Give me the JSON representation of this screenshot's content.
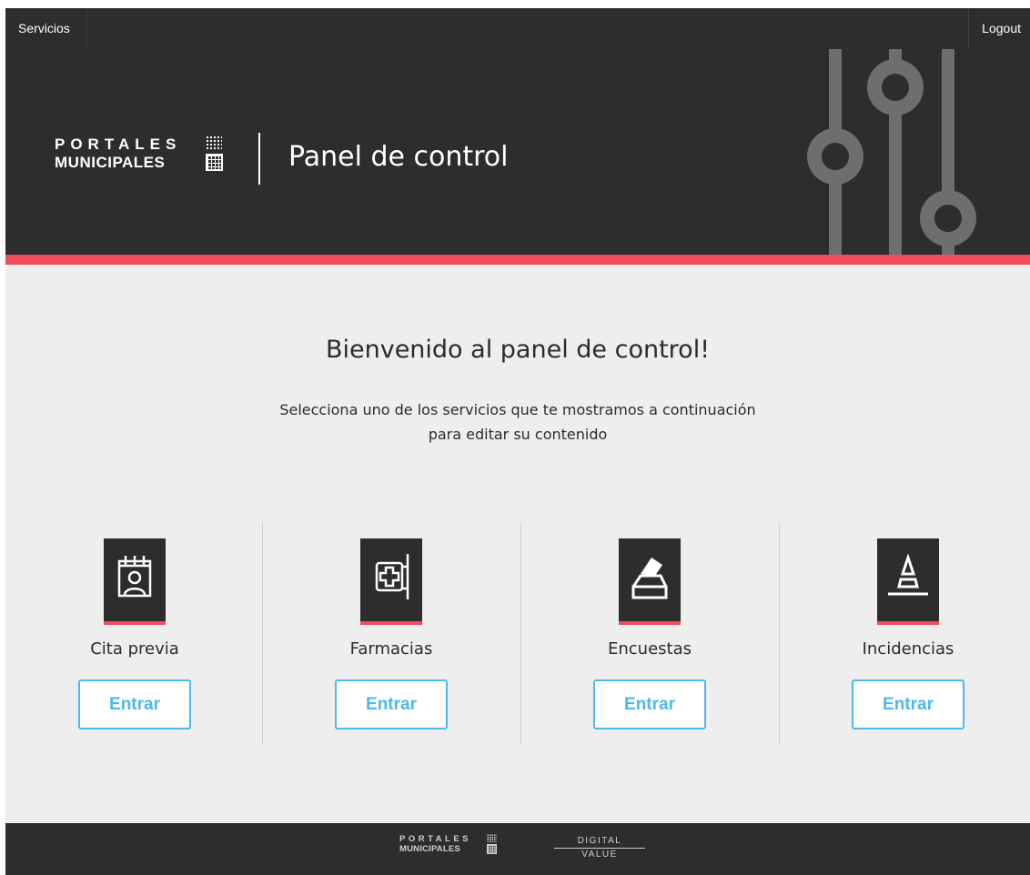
{
  "topbar": {
    "services_label": "Servicios",
    "logout_label": "Logout"
  },
  "header": {
    "logo": {
      "line1": "PORTALES",
      "line2": "MUNICIPALES"
    },
    "title": "Panel de control",
    "decoration_icon": "sliders-icon"
  },
  "welcome": {
    "title": "Bienvenido al panel de control!",
    "subtitle_line1": "Selecciona uno de los servicios que te mostramos a continuación",
    "subtitle_line2": "para editar su contenido"
  },
  "services": [
    {
      "label": "Cita previa",
      "icon": "calendar-person-icon",
      "button_label": "Entrar"
    },
    {
      "label": "Farmacias",
      "icon": "pharmacy-sign-icon",
      "button_label": "Entrar"
    },
    {
      "label": "Encuestas",
      "icon": "ballot-box-icon",
      "button_label": "Entrar"
    },
    {
      "label": "Incidencias",
      "icon": "traffic-cone-icon",
      "button_label": "Entrar"
    }
  ],
  "footer": {
    "logo_line1": "PORTALES",
    "logo_line2": "MUNICIPALES",
    "partner_line1": "DIGITAL",
    "partner_line2": "VALUE"
  },
  "colors": {
    "dark": "#2d2d2d",
    "accent_red": "#ef4d5a",
    "button_blue": "#4fb8ea",
    "background": "#eeeeee"
  }
}
